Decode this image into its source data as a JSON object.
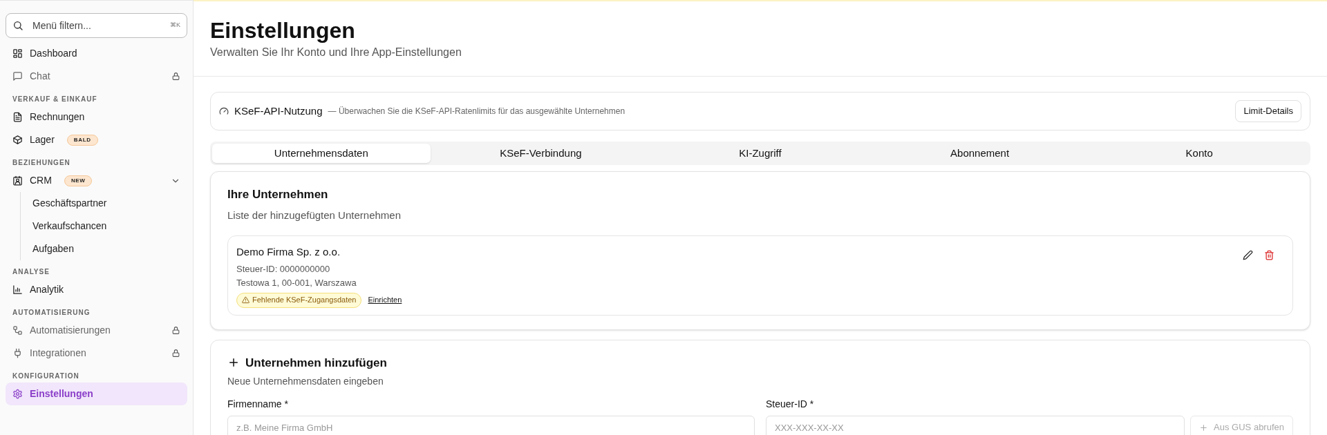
{
  "sidebar": {
    "search": {
      "placeholder": "Menü filtern...",
      "shortcut": "⌘K"
    },
    "sections": [
      {
        "items": [
          {
            "label": "Dashboard",
            "locked": false,
            "selected": false
          },
          {
            "label": "Chat",
            "locked": true,
            "selected": false
          }
        ]
      },
      {
        "heading": "VERKAUF & EINKAUF",
        "items": [
          {
            "label": "Rechnungen",
            "locked": false,
            "selected": false
          },
          {
            "label": "Lager",
            "locked": false,
            "selected": false,
            "badge": "BALD"
          }
        ]
      },
      {
        "heading": "BEZIEHUNGEN",
        "items": [
          {
            "label": "CRM",
            "locked": false,
            "selected": false,
            "badge": "NEW",
            "expanded": true,
            "children": [
              {
                "label": "Geschäftspartner",
                "selected": false
              },
              {
                "label": "Verkaufschancen",
                "selected": false
              },
              {
                "label": "Aufgaben",
                "selected": false
              }
            ]
          }
        ]
      },
      {
        "heading": "ANALYSE",
        "items": [
          {
            "label": "Analytik",
            "locked": false,
            "selected": false
          }
        ]
      },
      {
        "heading": "AUTOMATISIERUNG",
        "items": [
          {
            "label": "Automatisierungen",
            "locked": true,
            "selected": false
          },
          {
            "label": "Integrationen",
            "locked": true,
            "selected": false
          }
        ]
      },
      {
        "heading": "KONFIGURATION",
        "items": [
          {
            "label": "Einstellungen",
            "locked": false,
            "selected": true
          }
        ]
      }
    ]
  },
  "header": {
    "title": "Einstellungen",
    "subtitle": "Verwalten Sie Ihr Konto und Ihre App-Einstellungen"
  },
  "api_usage": {
    "title": "KSeF-API-Nutzung",
    "description": "— Überwachen Sie die KSeF-API-Ratenlimits für das ausgewählte Unternehmen",
    "button": "Limit-Details"
  },
  "tabs": [
    {
      "label": "Unternehmensdaten",
      "selected": true
    },
    {
      "label": "KSeF-Verbindung",
      "selected": false
    },
    {
      "label": "KI-Zugriff",
      "selected": false
    },
    {
      "label": "Abonnement",
      "selected": false
    },
    {
      "label": "Konto",
      "selected": false
    }
  ],
  "companies": {
    "title": "Ihre Unternehmen",
    "subtitle": "Liste der hinzugefügten Unternehmen",
    "items": [
      {
        "name": "Demo Firma Sp. z o.o.",
        "tax_id": "Steuer-ID: 0000000000",
        "address": "Testowa 1, 00-001, Warszawa",
        "warning": "Fehlende KSeF-Zugangsdaten",
        "action": "Einrichten"
      }
    ]
  },
  "add_company": {
    "title": "Unternehmen hinzufügen",
    "subtitle": "Neue Unternehmensdaten eingeben",
    "fields": [
      {
        "label": "Firmenname *",
        "placeholder": "z.B. Meine Firma GmbH"
      },
      {
        "label": "Steuer-ID *",
        "placeholder": "XXX-XXX-XX-XX"
      }
    ],
    "fetch_button": "Aus GUS abrufen"
  }
}
